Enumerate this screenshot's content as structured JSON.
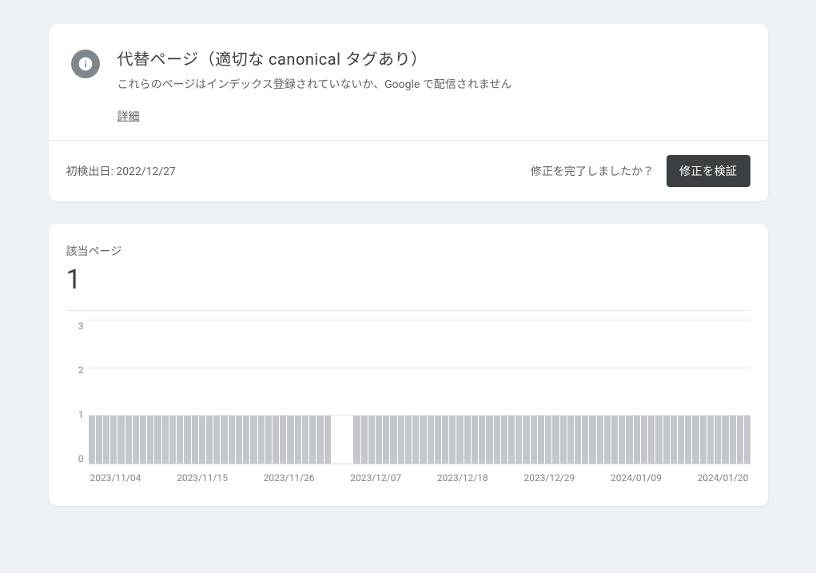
{
  "header": {
    "title": "代替ページ（適切な canonical タグあり）",
    "subtitle": "これらのページはインデックス登録されていないか、Google で配信されません",
    "learn_more": "詳細"
  },
  "action": {
    "first_detected_label": "初検出日:",
    "first_detected_value": "2022/12/27",
    "fix_prompt": "修正を完了しましたか？",
    "validate_btn": "修正を検証"
  },
  "chart": {
    "label": "該当ページ",
    "big_value": "1"
  },
  "chart_data": {
    "type": "bar",
    "title": "該当ページ",
    "ylabel": "",
    "xlabel": "",
    "ylim": [
      0,
      3
    ],
    "yticks": [
      0,
      1,
      2,
      3
    ],
    "xticks": [
      "2023/11/04",
      "2023/11/15",
      "2023/11/26",
      "2023/12/07",
      "2023/12/18",
      "2023/12/29",
      "2024/01/09",
      "2024/01/20"
    ],
    "values": [
      1,
      1,
      1,
      1,
      1,
      1,
      1,
      1,
      1,
      1,
      1,
      1,
      1,
      1,
      1,
      1,
      1,
      1,
      1,
      1,
      1,
      1,
      1,
      1,
      1,
      1,
      1,
      1,
      1,
      1,
      1,
      1,
      1,
      0,
      0,
      0,
      1,
      1,
      1,
      1,
      1,
      1,
      1,
      1,
      1,
      1,
      1,
      1,
      1,
      1,
      1,
      1,
      1,
      1,
      1,
      1,
      1,
      1,
      1,
      1,
      1,
      1,
      1,
      1,
      1,
      1,
      1,
      1,
      1,
      1,
      1,
      1,
      1,
      1,
      1,
      1,
      1,
      1,
      1,
      1,
      1,
      1,
      1,
      1,
      1,
      1,
      1,
      1,
      1,
      1
    ]
  }
}
